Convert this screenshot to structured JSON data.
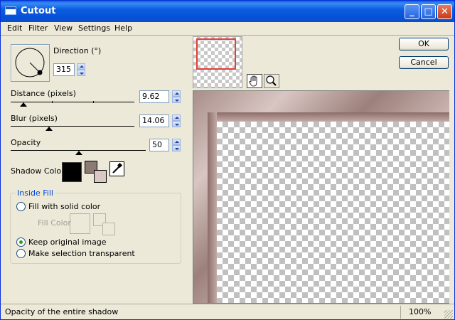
{
  "window": {
    "title": "Cutout"
  },
  "menu": [
    "Edit",
    "Filter",
    "View",
    "Settings",
    "Help"
  ],
  "controls": {
    "direction": {
      "label": "Direction (°)",
      "value": "315"
    },
    "distance": {
      "label": "Distance (pixels)",
      "value": "9.62"
    },
    "blur": {
      "label": "Blur (pixels)",
      "value": "14.06"
    },
    "opacity": {
      "label": "Opacity",
      "value": "50"
    },
    "shadow_color": {
      "label": "Shadow Color",
      "color": "#000000"
    }
  },
  "inside_fill": {
    "title": "Inside Fill",
    "options": [
      "Fill with solid color",
      "Keep original image",
      "Make selection transparent"
    ],
    "selected": "Keep original image",
    "fill_color_label": "Fill Color"
  },
  "buttons": {
    "ok": "OK",
    "cancel": "Cancel"
  },
  "preview_tools": [
    "hand-icon",
    "zoom-icon"
  ],
  "status": {
    "text": "Opacity of the entire shadow",
    "zoom": "100%"
  },
  "colors": {
    "titlebar": "#0a5fd8",
    "dialog": "#ece9d8",
    "nav_rect": "#e0403a"
  }
}
